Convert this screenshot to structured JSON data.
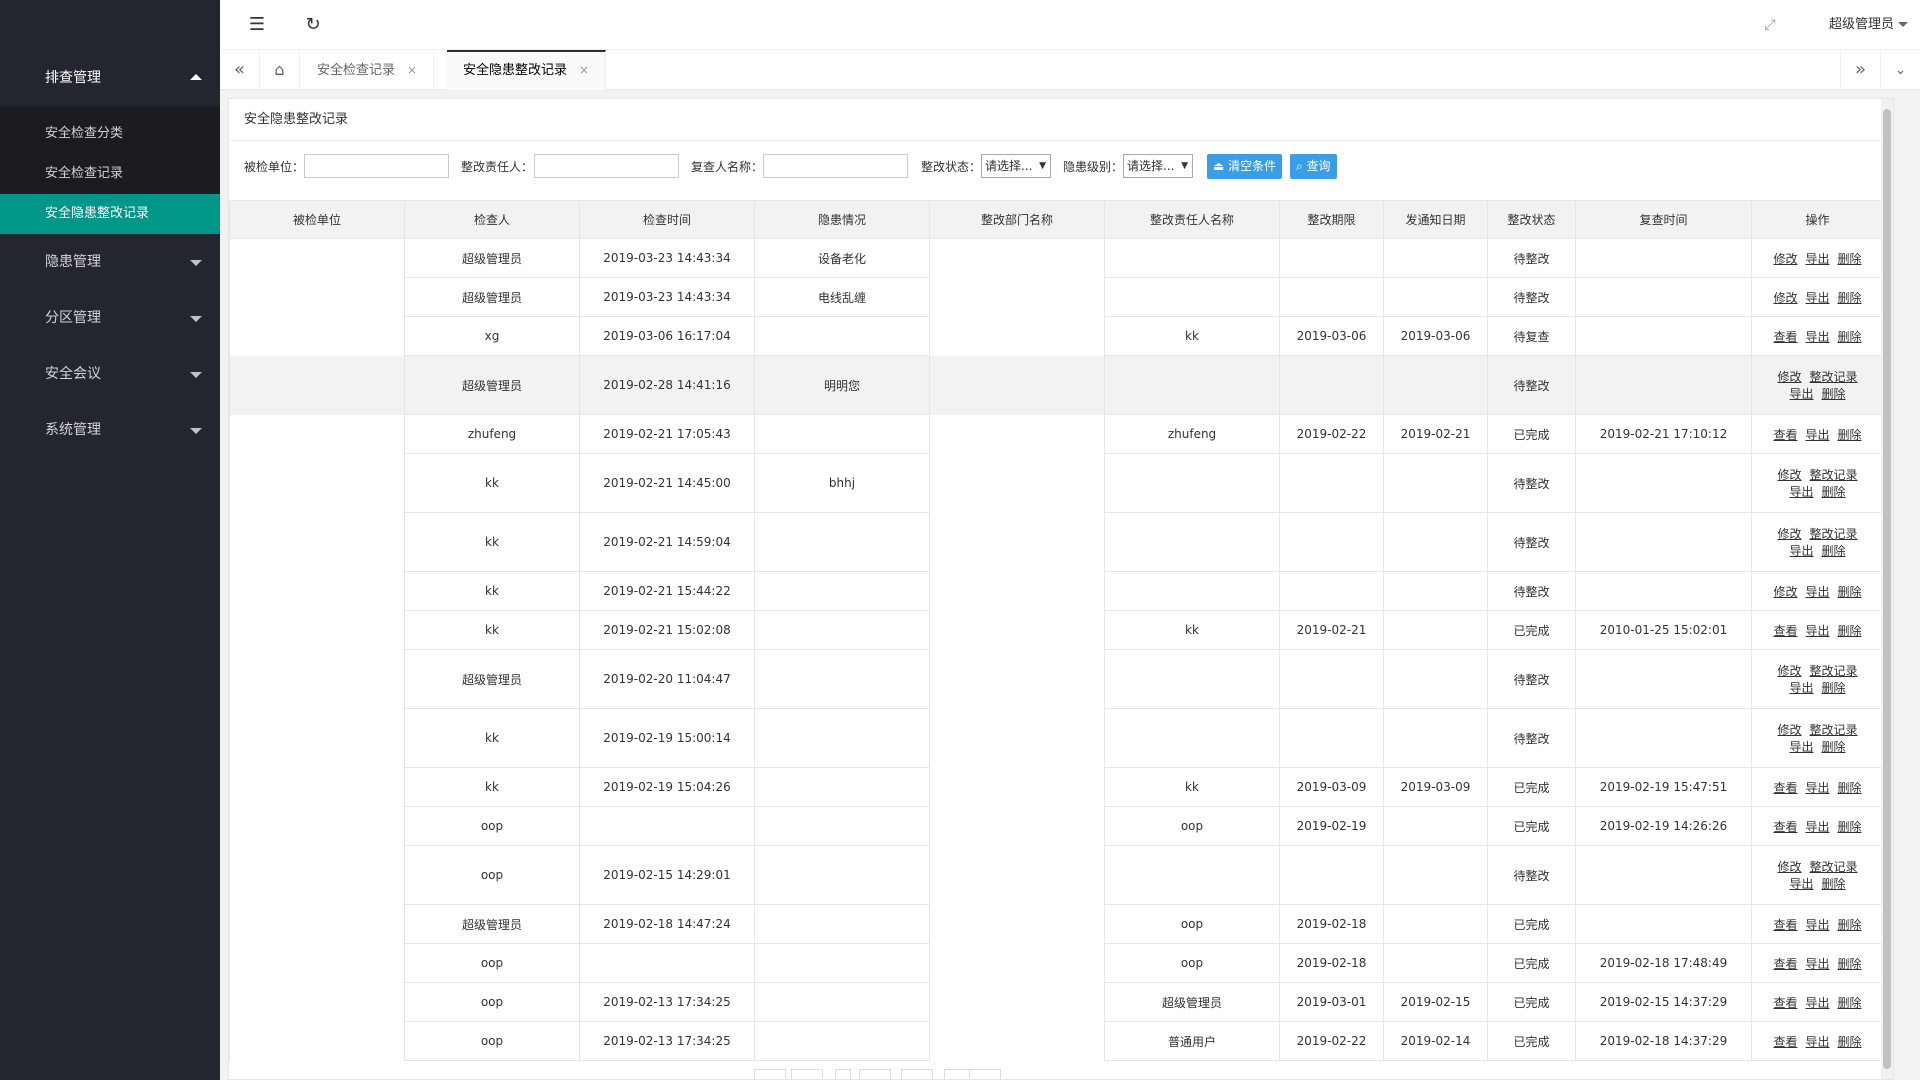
{
  "sidebar": {
    "groups": [
      {
        "label": "排查管理",
        "open": true,
        "items": [
          {
            "label": "安全检查分类"
          },
          {
            "label": "安全检查记录"
          },
          {
            "label": "安全隐患整改记录",
            "active": true
          }
        ]
      },
      {
        "label": "隐患管理"
      },
      {
        "label": "分区管理"
      },
      {
        "label": "安全会议"
      },
      {
        "label": "系统管理"
      }
    ]
  },
  "header": {
    "user": "超级管理员"
  },
  "tabs": {
    "items": [
      {
        "label": "安全检查记录",
        "close": "×"
      },
      {
        "label": "安全隐患整改记录",
        "close": "×",
        "active": true
      }
    ]
  },
  "panel": {
    "title": "安全隐患整改记录"
  },
  "filters": {
    "unit_label": "被检单位：",
    "resp_label": "整改责任人：",
    "reviewer_label": "复查人名称：",
    "status_label": "整改状态：",
    "status_value": "请选择...",
    "level_label": "隐患级别：",
    "level_value": "请选择...",
    "clear_label": "清空条件",
    "query_label": "查询"
  },
  "table": {
    "headers": [
      "被检单位",
      "检查人",
      "检查时间",
      "隐患情况",
      "整改部门名称",
      "整改责任人名称",
      "整改期限",
      "发通知日期",
      "整改状态",
      "复查时间",
      "操作"
    ],
    "rows": [
      {
        "h": 1,
        "inspector": "超级管理员",
        "time": "2019-03-23 14:43:34",
        "hazard": "设备老化",
        "resp": "",
        "deadline": "",
        "notice": "",
        "status": "待整改",
        "review": "",
        "ops": [
          "修改",
          "导出",
          "删除"
        ]
      },
      {
        "h": 1,
        "inspector": "超级管理员",
        "time": "2019-03-23 14:43:34",
        "hazard": "电线乱缠",
        "resp": "",
        "deadline": "",
        "notice": "",
        "status": "待整改",
        "review": "",
        "ops": [
          "修改",
          "导出",
          "删除"
        ]
      },
      {
        "h": 1,
        "inspector": "xg",
        "time": "2019-03-06 16:17:04",
        "hazard": "",
        "resp": "kk",
        "deadline": "2019-03-06",
        "notice": "2019-03-06",
        "status": "待复查",
        "review": "",
        "ops": [
          "查看",
          "导出",
          "删除"
        ]
      },
      {
        "h": 2,
        "hl": true,
        "inspector": "超级管理员",
        "time": "2019-02-28 14:41:16",
        "hazard": "明明您",
        "resp": "",
        "deadline": "",
        "notice": "",
        "status": "待整改",
        "review": "",
        "ops": [
          "修改",
          "整改记录",
          "导出",
          "删除"
        ]
      },
      {
        "h": 1,
        "inspector": "zhufeng",
        "time": "2019-02-21 17:05:43",
        "hazard": "",
        "resp": "zhufeng",
        "deadline": "2019-02-22",
        "notice": "2019-02-21",
        "status": "已完成",
        "review": "2019-02-21 17:10:12",
        "ops": [
          "查看",
          "导出",
          "删除"
        ]
      },
      {
        "h": 2,
        "inspector": "kk",
        "time": "2019-02-21 14:45:00",
        "hazard": "bhhj",
        "resp": "",
        "deadline": "",
        "notice": "",
        "status": "待整改",
        "review": "",
        "ops": [
          "修改",
          "整改记录",
          "导出",
          "删除"
        ]
      },
      {
        "h": 2,
        "inspector": "kk",
        "time": "2019-02-21 14:59:04",
        "hazard": "",
        "resp": "",
        "deadline": "",
        "notice": "",
        "status": "待整改",
        "review": "",
        "ops": [
          "修改",
          "整改记录",
          "导出",
          "删除"
        ]
      },
      {
        "h": 1,
        "inspector": "kk",
        "time": "2019-02-21 15:44:22",
        "hazard": "",
        "resp": "",
        "deadline": "",
        "notice": "",
        "status": "待整改",
        "review": "",
        "ops": [
          "修改",
          "导出",
          "删除"
        ]
      },
      {
        "h": 1,
        "inspector": "kk",
        "time": "2019-02-21 15:02:08",
        "hazard": "",
        "resp": "kk",
        "deadline": "2019-02-21",
        "notice": "",
        "status": "已完成",
        "review": "2010-01-25 15:02:01",
        "ops": [
          "查看",
          "导出",
          "删除"
        ]
      },
      {
        "h": 2,
        "inspector": "超级管理员",
        "time": "2019-02-20 11:04:47",
        "hazard": "",
        "resp": "",
        "deadline": "",
        "notice": "",
        "status": "待整改",
        "review": "",
        "ops": [
          "修改",
          "整改记录",
          "导出",
          "删除"
        ]
      },
      {
        "h": 2,
        "inspector": "kk",
        "time": "2019-02-19 15:00:14",
        "hazard": "",
        "resp": "",
        "deadline": "",
        "notice": "",
        "status": "待整改",
        "review": "",
        "ops": [
          "修改",
          "整改记录",
          "导出",
          "删除"
        ]
      },
      {
        "h": 1,
        "inspector": "kk",
        "time": "2019-02-19 15:04:26",
        "hazard": "",
        "resp": "kk",
        "deadline": "2019-03-09",
        "notice": "2019-03-09",
        "status": "已完成",
        "review": "2019-02-19 15:47:51",
        "ops": [
          "查看",
          "导出",
          "删除"
        ]
      },
      {
        "h": 1,
        "inspector": "oop",
        "time": "",
        "hazard": "",
        "resp": "oop",
        "deadline": "2019-02-19",
        "notice": "",
        "status": "已完成",
        "review": "2019-02-19 14:26:26",
        "ops": [
          "查看",
          "导出",
          "删除"
        ]
      },
      {
        "h": 2,
        "inspector": "oop",
        "time": "2019-02-15 14:29:01",
        "hazard": "",
        "resp": "",
        "deadline": "",
        "notice": "",
        "status": "待整改",
        "review": "",
        "ops": [
          "修改",
          "整改记录",
          "导出",
          "删除"
        ]
      },
      {
        "h": 1,
        "inspector": "超级管理员",
        "time": "2019-02-18 14:47:24",
        "hazard": "",
        "resp": "oop",
        "deadline": "2019-02-18",
        "notice": "",
        "status": "已完成",
        "review": "",
        "ops": [
          "查看",
          "导出",
          "删除"
        ]
      },
      {
        "h": 1,
        "inspector": "oop",
        "time": "",
        "hazard": "",
        "resp": "oop",
        "deadline": "2019-02-18",
        "notice": "",
        "status": "已完成",
        "review": "2019-02-18 17:48:49",
        "ops": [
          "查看",
          "导出",
          "删除"
        ]
      },
      {
        "h": 1,
        "inspector": "oop",
        "time": "2019-02-13 17:34:25",
        "hazard": "",
        "resp": "超级管理员",
        "deadline": "2019-03-01",
        "notice": "2019-02-15",
        "status": "已完成",
        "review": "2019-02-15 14:37:29",
        "ops": [
          "查看",
          "导出",
          "删除"
        ]
      },
      {
        "h": 1,
        "inspector": "oop",
        "time": "2019-02-13 17:34:25",
        "hazard": "",
        "resp": "普通用户",
        "deadline": "2019-02-22",
        "notice": "2019-02-14",
        "status": "已完成",
        "review": "2019-02-18 14:37:29",
        "ops": [
          "查看",
          "导出",
          "删除"
        ]
      }
    ]
  }
}
